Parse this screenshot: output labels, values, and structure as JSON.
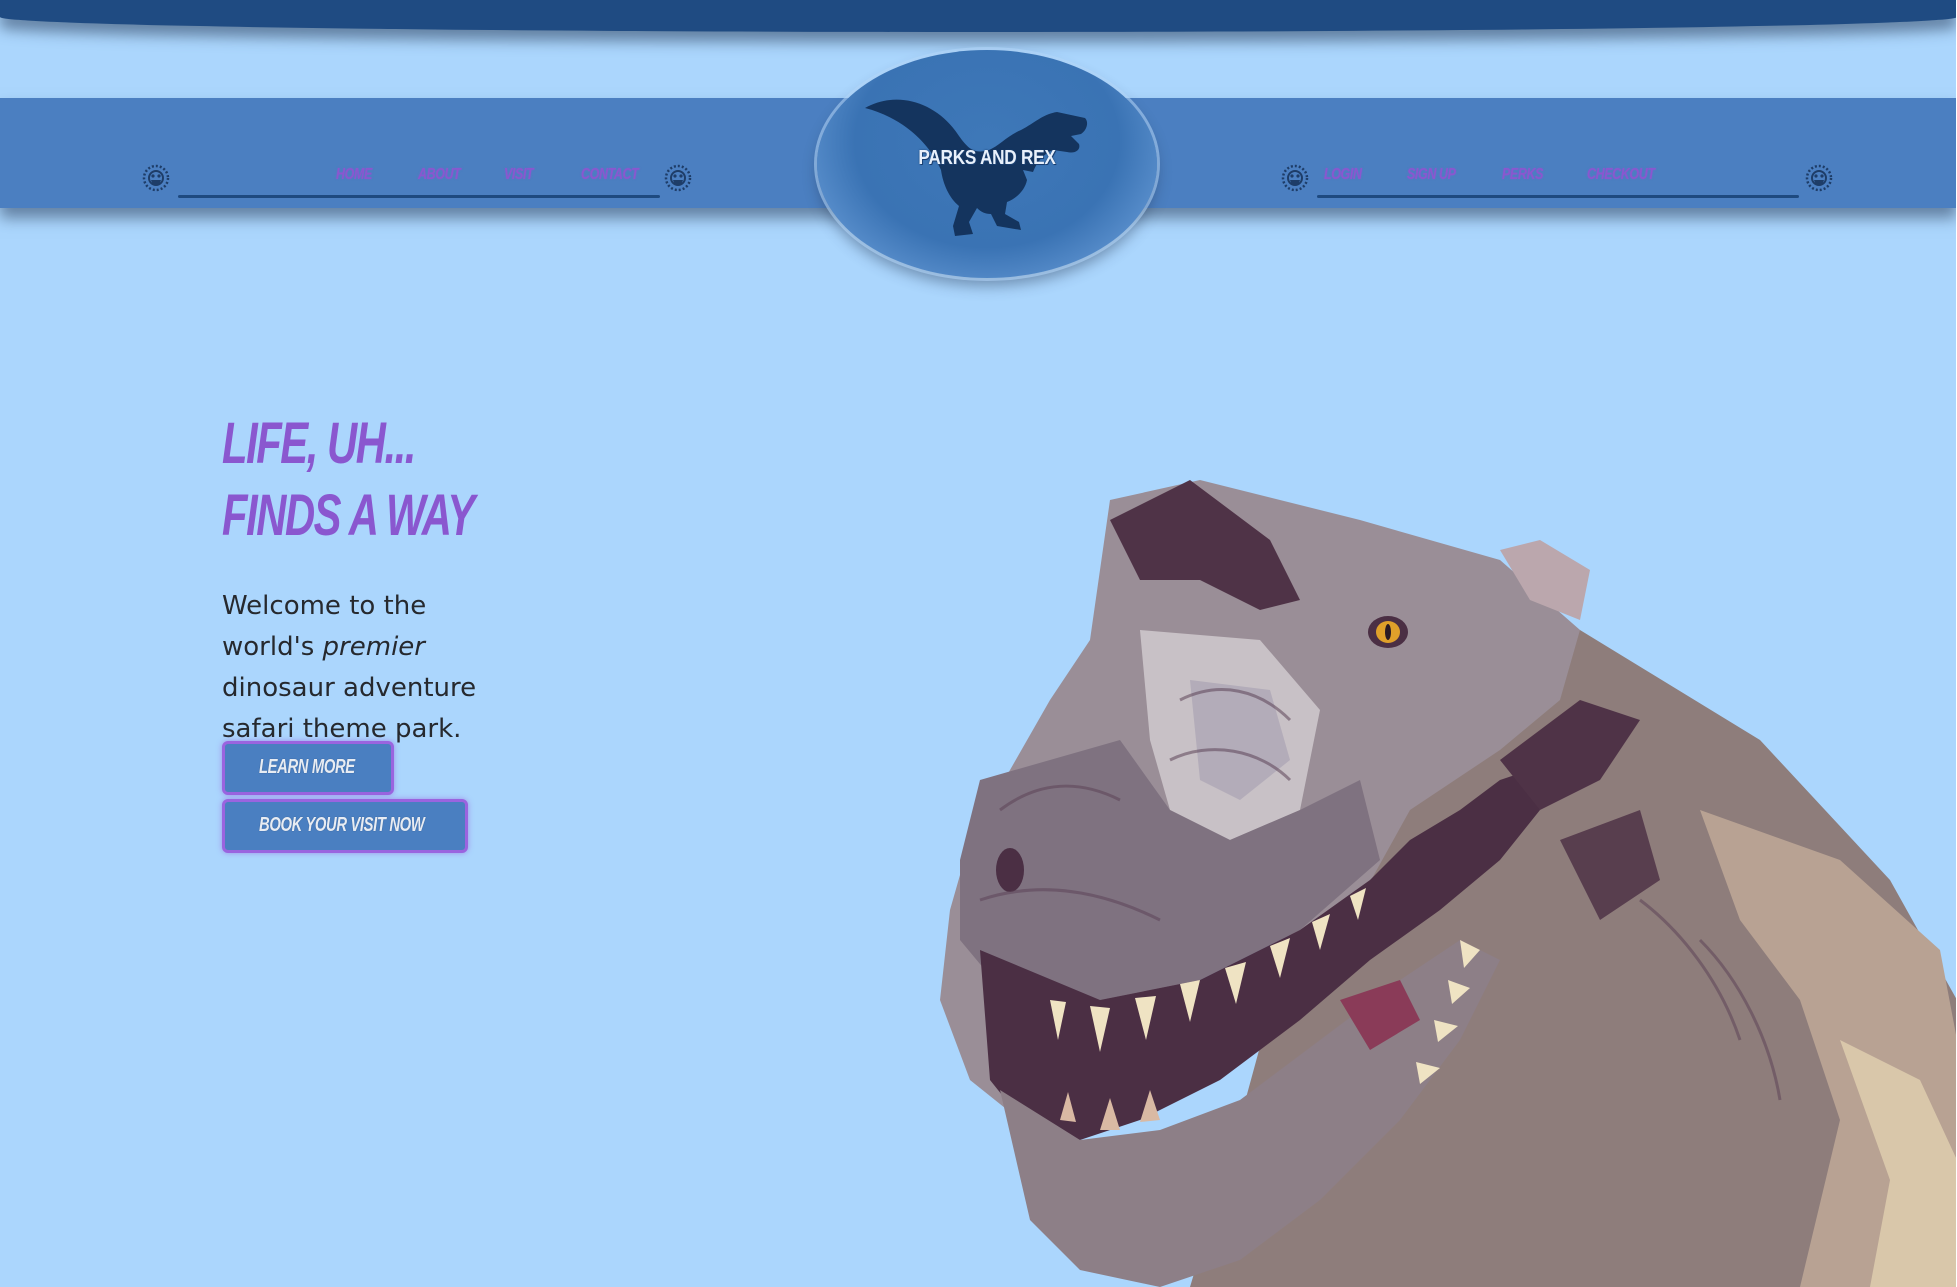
{
  "brand": {
    "name": "PARKS AND REX"
  },
  "nav_left": [
    {
      "label": "HOME"
    },
    {
      "label": "ABOUT"
    },
    {
      "label": "VISIT"
    },
    {
      "label": "CONTACT"
    }
  ],
  "nav_right": [
    {
      "label": "LOGIN"
    },
    {
      "label": "SIGN UP"
    },
    {
      "label": "PERKS"
    },
    {
      "label": "CHECKOUT"
    }
  ],
  "hero": {
    "title_line1": "LIFE, UH...",
    "title_line2": "FINDS A WAY",
    "body_before": "Welcome to the world's ",
    "body_emphasis": "premier",
    "body_after": " dinosaur adventure safari theme park."
  },
  "buttons": {
    "learn_more": "LEARN MORE",
    "book_visit": "BOOK YOUR VISIT NOW"
  },
  "colors": {
    "background": "#abd6fd",
    "nav_band": "#4b7fc1",
    "top_cap": "#1f4b82",
    "accent_purple": "#8a57cf",
    "button_fill": "#4a7fc1"
  },
  "icons": {
    "nav_ornament": "dinosaur-skull-icon",
    "logo": "t-rex-silhouette-icon",
    "hero_image": "t-rex-head-illustration"
  }
}
